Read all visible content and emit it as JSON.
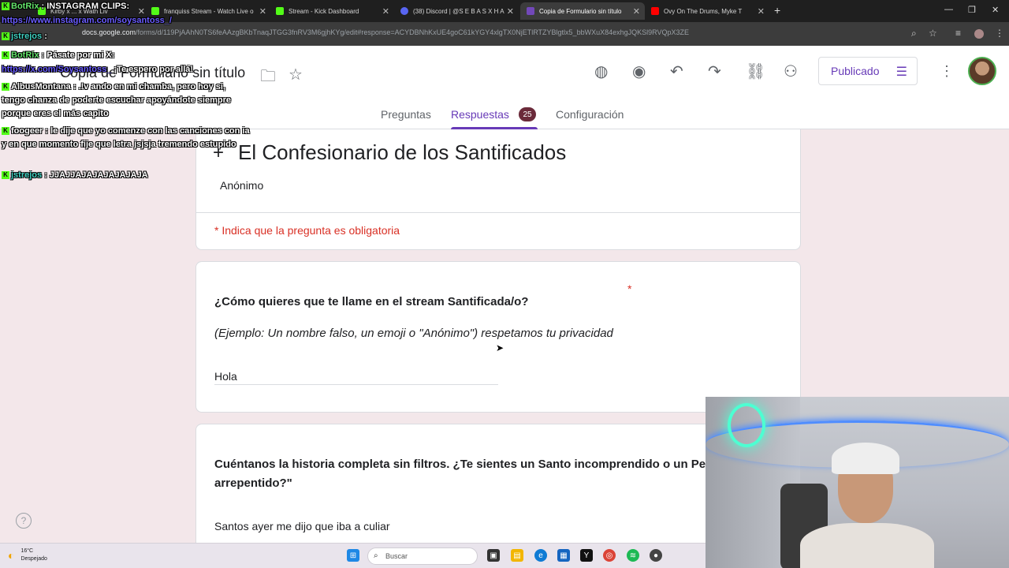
{
  "browser": {
    "tabs": [
      {
        "label": "Kirby x ... x Wath Liv",
        "active": false
      },
      {
        "label": "franquiss Stream - Watch Live o",
        "active": false
      },
      {
        "label": "Stream - Kick Dashboard",
        "active": false
      },
      {
        "label": "(38) Discord | @S E B A S X H A",
        "active": false
      },
      {
        "label": "Copia de Formulario sin título",
        "active": true
      },
      {
        "label": "Ovy On The Drums, Myke T",
        "active": false
      }
    ],
    "url_domain": "docs.google.com",
    "url_path": "/forms/d/119PjAAhN0TS6feAAzgBKbTnaqJTGG3fnRV3M6gjhKYg/edit#response=ACYDBNhKxUE4goC61kYGY4xlgTX0NjETlRTZYBlgtlx5_bbWXuX84exhgJQKSl9RVQpX3ZE"
  },
  "forms": {
    "doc_title": "Copia de Formulario sin título",
    "publish_label": "Publicado",
    "tabs": {
      "questions": "Preguntas",
      "responses": "Respuestas",
      "responses_count": "25",
      "settings": "Configuración"
    }
  },
  "form": {
    "title": "El Confesionario de los Santificados",
    "respondent": "Anónimo",
    "required_note": "* Indica que la pregunta es obligatoria",
    "q1": {
      "title": "¿Cómo quieres que te llame en el stream Santificada/o?",
      "description": "(Ejemplo: Un nombre falso, un emoji o \"Anónimo\") respetamos tu privacidad",
      "required_mark": "*",
      "answer": "Hola"
    },
    "q2": {
      "title_line1": "Cuéntanos la historia completa sin filtros. ¿Te sientes un Santo incomprendido o un Pe",
      "title_line2": "arrepentido?\"",
      "answer": "Santos ayer me dijo  que iba a culiar"
    }
  },
  "taskbar": {
    "temp": "16°C",
    "weather": "Despejado",
    "search_placeholder": "Buscar"
  },
  "chat": {
    "line1_user": "BotRix",
    "line1_text": ": INSTAGRAM CLIPS:",
    "line2_link": "https://www.instagram.com/soysantoss_/",
    "line3_user": "jstrejos",
    "line3_text": ":",
    "line4_user": "BotRix",
    "line4_text": ": Pásate por mi X:",
    "line5_link": "https://x.com/Soysantoss_",
    "line5_text": "¡Te espero por allá!",
    "line6_user": "AlbusMontana",
    "line6_text": ": .!v ando en mi chamba, pero hoy si, tengo chanza de poderte escuchar apoyándote siempre porque eres el más capito",
    "line7_user": "foogeer",
    "line7_text": ": le dije que yo comenze con las canciones con ia y en que momento fije que letra jsjsja tremendo estupido",
    "line8_user": "jstrejos",
    "line8_text": ": JJAJJAJAJAJAJAJAJA"
  },
  "colors": {
    "accent": "#673ab7",
    "required": "#d93025",
    "page_bg": "#f3e7ea"
  }
}
